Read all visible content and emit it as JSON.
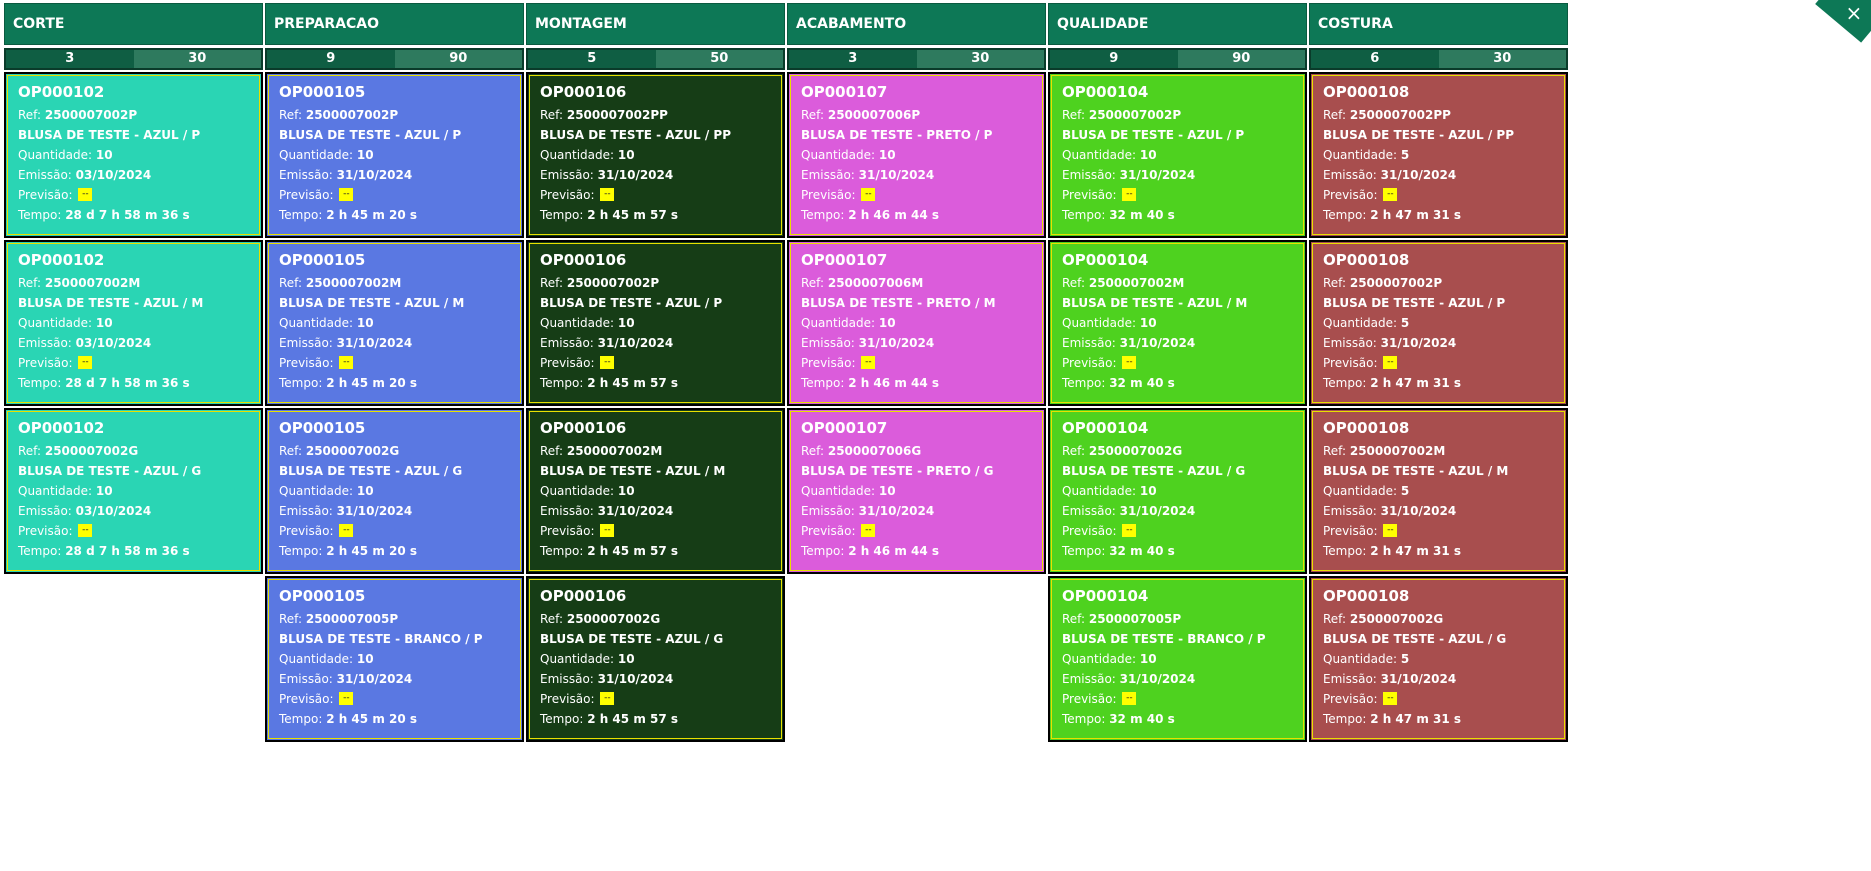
{
  "close_label": "×",
  "columns": [
    {
      "title": "CORTE",
      "count_a": "3",
      "count_b": "30",
      "color": "#2ad5b4",
      "cards": [
        {
          "op": "OP000102",
          "ref": "2500007002P",
          "product": "BLUSA DE TESTE - AZUL / P",
          "qty": "10",
          "emission": "03/10/2024",
          "prev": "--",
          "time": "28 d 7 h 58 m 36 s"
        },
        {
          "op": "OP000102",
          "ref": "2500007002M",
          "product": "BLUSA DE TESTE - AZUL / M",
          "qty": "10",
          "emission": "03/10/2024",
          "prev": "--",
          "time": "28 d 7 h 58 m 36 s"
        },
        {
          "op": "OP000102",
          "ref": "2500007002G",
          "product": "BLUSA DE TESTE - AZUL / G",
          "qty": "10",
          "emission": "03/10/2024",
          "prev": "--",
          "time": "28 d 7 h 58 m 36 s"
        }
      ]
    },
    {
      "title": "PREPARACAO",
      "count_a": "9",
      "count_b": "90",
      "color": "#5a78e2",
      "cards": [
        {
          "op": "OP000105",
          "ref": "2500007002P",
          "product": "BLUSA DE TESTE - AZUL / P",
          "qty": "10",
          "emission": "31/10/2024",
          "prev": "--",
          "time": "2 h 45 m 20 s"
        },
        {
          "op": "OP000105",
          "ref": "2500007002M",
          "product": "BLUSA DE TESTE - AZUL / M",
          "qty": "10",
          "emission": "31/10/2024",
          "prev": "--",
          "time": "2 h 45 m 20 s"
        },
        {
          "op": "OP000105",
          "ref": "2500007002G",
          "product": "BLUSA DE TESTE - AZUL / G",
          "qty": "10",
          "emission": "31/10/2024",
          "prev": "--",
          "time": "2 h 45 m 20 s"
        },
        {
          "op": "OP000105",
          "ref": "2500007005P",
          "product": "BLUSA DE TESTE - BRANCO / P",
          "qty": "10",
          "emission": "31/10/2024",
          "prev": "--",
          "time": "2 h 45 m 20 s"
        }
      ]
    },
    {
      "title": "MONTAGEM",
      "count_a": "5",
      "count_b": "50",
      "color": "#163d16",
      "cards": [
        {
          "op": "OP000106",
          "ref": "2500007002PP",
          "product": "BLUSA DE TESTE - AZUL / PP",
          "qty": "10",
          "emission": "31/10/2024",
          "prev": "--",
          "time": "2 h 45 m 57 s"
        },
        {
          "op": "OP000106",
          "ref": "2500007002P",
          "product": "BLUSA DE TESTE - AZUL / P",
          "qty": "10",
          "emission": "31/10/2024",
          "prev": "--",
          "time": "2 h 45 m 57 s"
        },
        {
          "op": "OP000106",
          "ref": "2500007002M",
          "product": "BLUSA DE TESTE - AZUL / M",
          "qty": "10",
          "emission": "31/10/2024",
          "prev": "--",
          "time": "2 h 45 m 57 s"
        },
        {
          "op": "OP000106",
          "ref": "2500007002G",
          "product": "BLUSA DE TESTE - AZUL / G",
          "qty": "10",
          "emission": "31/10/2024",
          "prev": "--",
          "time": "2 h 45 m 57 s"
        }
      ]
    },
    {
      "title": "ACABAMENTO",
      "count_a": "3",
      "count_b": "30",
      "color": "#db5cdb",
      "cards": [
        {
          "op": "OP000107",
          "ref": "2500007006P",
          "product": "BLUSA DE TESTE - PRETO / P",
          "qty": "10",
          "emission": "31/10/2024",
          "prev": "--",
          "time": "2 h 46 m 44 s"
        },
        {
          "op": "OP000107",
          "ref": "2500007006M",
          "product": "BLUSA DE TESTE - PRETO / M",
          "qty": "10",
          "emission": "31/10/2024",
          "prev": "--",
          "time": "2 h 46 m 44 s"
        },
        {
          "op": "OP000107",
          "ref": "2500007006G",
          "product": "BLUSA DE TESTE - PRETO / G",
          "qty": "10",
          "emission": "31/10/2024",
          "prev": "--",
          "time": "2 h 46 m 44 s"
        }
      ]
    },
    {
      "title": "QUALIDADE",
      "count_a": "9",
      "count_b": "90",
      "color": "#4ed21f",
      "cards": [
        {
          "op": "OP000104",
          "ref": "2500007002P",
          "product": "BLUSA DE TESTE - AZUL / P",
          "qty": "10",
          "emission": "31/10/2024",
          "prev": "--",
          "time": "32 m 40 s"
        },
        {
          "op": "OP000104",
          "ref": "2500007002M",
          "product": "BLUSA DE TESTE - AZUL / M",
          "qty": "10",
          "emission": "31/10/2024",
          "prev": "--",
          "time": "32 m 40 s"
        },
        {
          "op": "OP000104",
          "ref": "2500007002G",
          "product": "BLUSA DE TESTE - AZUL / G",
          "qty": "10",
          "emission": "31/10/2024",
          "prev": "--",
          "time": "32 m 40 s"
        },
        {
          "op": "OP000104",
          "ref": "2500007005P",
          "product": "BLUSA DE TESTE - BRANCO / P",
          "qty": "10",
          "emission": "31/10/2024",
          "prev": "--",
          "time": "32 m 40 s"
        }
      ]
    },
    {
      "title": "COSTURA",
      "count_a": "6",
      "count_b": "30",
      "color": "#a84e4e",
      "cards": [
        {
          "op": "OP000108",
          "ref": "2500007002PP",
          "product": "BLUSA DE TESTE - AZUL / PP",
          "qty": "5",
          "emission": "31/10/2024",
          "prev": "--",
          "time": "2 h 47 m 31 s"
        },
        {
          "op": "OP000108",
          "ref": "2500007002P",
          "product": "BLUSA DE TESTE - AZUL / P",
          "qty": "5",
          "emission": "31/10/2024",
          "prev": "--",
          "time": "2 h 47 m 31 s"
        },
        {
          "op": "OP000108",
          "ref": "2500007002M",
          "product": "BLUSA DE TESTE - AZUL / M",
          "qty": "5",
          "emission": "31/10/2024",
          "prev": "--",
          "time": "2 h 47 m 31 s"
        },
        {
          "op": "OP000108",
          "ref": "2500007002G",
          "product": "BLUSA DE TESTE - AZUL / G",
          "qty": "5",
          "emission": "31/10/2024",
          "prev": "--",
          "time": "2 h 47 m 31 s"
        }
      ]
    }
  ],
  "labels": {
    "ref": "Ref: ",
    "qty": "Quantidade: ",
    "emission": "Emissão: ",
    "prev": "Previsão: ",
    "time": "Tempo: "
  }
}
